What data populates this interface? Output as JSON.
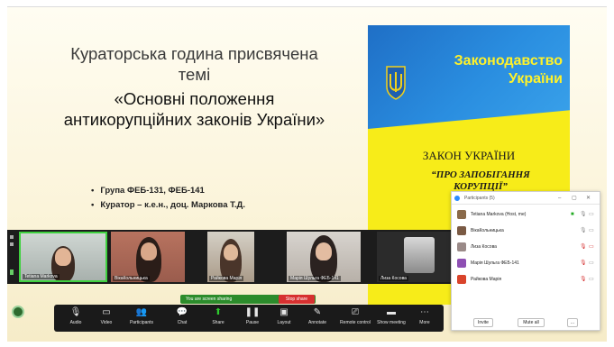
{
  "slide": {
    "title_line1": "Кураторська година присвячена",
    "title_line2": "темі",
    "title_line3": "«Основні положення",
    "title_line4": "антикорупційних законів України»",
    "bullets": [
      "Група ФЕБ-131, ФЕБ-141",
      "Куратор – к.е.н., доц. Маркова Т.Д."
    ]
  },
  "book": {
    "heading_line1": "Законодавство",
    "heading_line2": "України",
    "law_title": "ЗАКОН УКРАЇНИ",
    "law_subtitle": "“ПРО ЗАПОБІГАННЯ КОРУПЦІЇ”",
    "colors": {
      "yellow": "#f7ec19",
      "blue": "#2a8ee0"
    }
  },
  "video_tiles": [
    {
      "name": "Tetiana Markova",
      "active": true
    },
    {
      "name": "ВікаКольницька",
      "active": false
    },
    {
      "name": "Райкова Марія",
      "active": false
    },
    {
      "name": "Марія Шульга ФЕБ-141",
      "active": false
    },
    {
      "name": "Лиза Косова",
      "active": false
    }
  ],
  "sharing": {
    "status": "You are screen sharing",
    "stop_label": "Stop share"
  },
  "toolbar": {
    "items": [
      {
        "label": "Audio",
        "icon": "microphone-icon"
      },
      {
        "label": "Video",
        "icon": "video-icon"
      },
      {
        "label": "Participants",
        "icon": "participants-icon",
        "count": "5"
      },
      {
        "label": "Chat",
        "icon": "chat-icon"
      },
      {
        "label": "Share",
        "icon": "share-icon"
      },
      {
        "label": "Pause",
        "icon": "pause-icon"
      },
      {
        "label": "Layout",
        "icon": "layout-icon"
      },
      {
        "label": "Annotate",
        "icon": "annotate-icon"
      },
      {
        "label": "Remote control",
        "icon": "remote-control-icon"
      },
      {
        "label": "Show meeting",
        "icon": "show-meeting-icon"
      },
      {
        "label": "More",
        "icon": "more-icon"
      }
    ]
  },
  "participants": {
    "title": "Participants (5)",
    "list": [
      {
        "name": "Tetiana Markova (Host, me)",
        "muted": false,
        "video": true,
        "avatar_color": "#8a6a4a"
      },
      {
        "name": "ВікаКольницька",
        "muted": false,
        "video": false,
        "avatar_color": "#7a5a44"
      },
      {
        "name": "Лиза Косова",
        "muted": true,
        "video": false,
        "avatar_color": "#9a8a88"
      },
      {
        "name": "Марія Шульга ФЕБ-141",
        "muted": true,
        "video": false,
        "avatar_color": "#8e4fb3"
      },
      {
        "name": "Райкова Марія",
        "muted": true,
        "video": false,
        "avatar_color": "#d9442b"
      }
    ],
    "invite_label": "Invite",
    "mute_all_label": "Mute all",
    "more_label": "..."
  }
}
